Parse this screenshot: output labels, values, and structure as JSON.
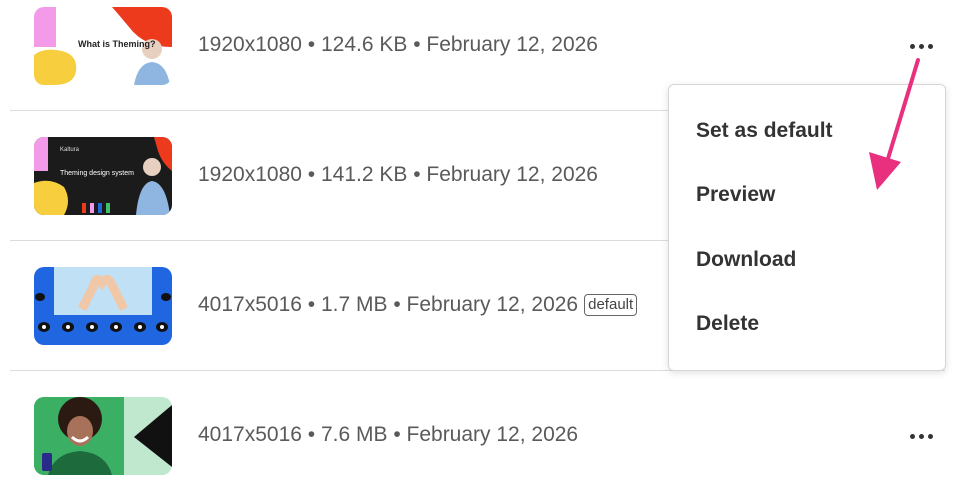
{
  "files": [
    {
      "meta": "1920x1080 • 124.6 KB • February 12, 2026",
      "badge": "",
      "thumb_text": "What is Theming?"
    },
    {
      "meta": "1920x1080 • 141.2 KB • February 12, 2026",
      "badge": "",
      "thumb_text": "Theming design system",
      "thumb_brand": "Kaltura"
    },
    {
      "meta": "4017x5016 • 1.7 MB • February 12, 2026",
      "badge": "default",
      "thumb_text": ""
    },
    {
      "meta": "4017x5016 • 7.6 MB • February 12, 2026",
      "badge": "",
      "thumb_text": ""
    }
  ],
  "menu": {
    "items": [
      "Set as default",
      "Preview",
      "Download",
      "Delete"
    ]
  },
  "colors": {
    "annotation_arrow": "#e8307f",
    "thumb_blue": "#1f66e0",
    "thumb_red": "#ee3a1c",
    "thumb_yellow": "#f7cf3e",
    "thumb_pink": "#f39be8"
  }
}
